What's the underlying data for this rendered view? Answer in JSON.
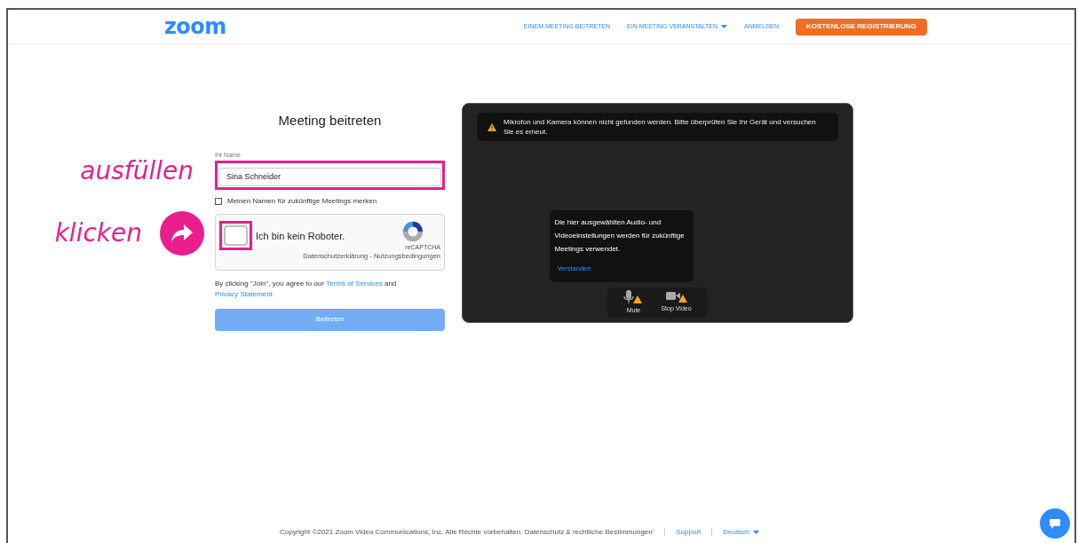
{
  "header": {
    "logo": "zoom",
    "nav": [
      {
        "label": "EINEM MEETING BEITRETEN",
        "dropdown": false
      },
      {
        "label": "EIN MEETING VERANSTALTEN",
        "dropdown": true
      },
      {
        "label": "ANMELDEN",
        "dropdown": false
      }
    ],
    "cta": "KOSTENLOSE REGISTRIERUNG"
  },
  "annotations": [
    {
      "label": "ausfüllen",
      "kind": "text"
    },
    {
      "label": "klicken",
      "kind": "arrow"
    }
  ],
  "form": {
    "title": "Meeting beitreten",
    "name_label": "Ihr Name",
    "name_value": "Sina Schneider",
    "remember": {
      "label": "Meinen Namen für zukünftige Meetings merken",
      "checked": false
    },
    "captcha": {
      "label": "Ich bin kein Roboter.",
      "checked": false,
      "brand": "reCAPTCHA",
      "links": "Datenschutzerklärung - Nutzungsbedingungen"
    },
    "terms": {
      "before": "By clicking \"Join\", you agree to our ",
      "link1": "Terms of Services",
      "middle": " and ",
      "link2": "Privacy Statement"
    },
    "submit": {
      "label": "Beitreten",
      "disabled": true
    }
  },
  "preview": {
    "warning": "Mikrofon und Kamera können nicht gefunden werden. Bitte überprüfen Sie Ihr Gerät und versuchen Sie es erneut.",
    "tooltip": {
      "text": "Die hier ausgewählten Audio- und Videoeinstellungen werden für zukünftige Meetings verwendet.",
      "link": "Verstanden"
    },
    "controls": [
      {
        "label": "Mute",
        "kind": "mic"
      },
      {
        "label": "Stop Video",
        "kind": "video"
      }
    ]
  },
  "footer": {
    "copyright": "Copyright ©2021 Zoom Video Communications, Inc. Alle Rechte vorbehalten. Datenschutz & rechtliche Bestimmungen'",
    "support": "Support",
    "language": "Deutsch"
  }
}
